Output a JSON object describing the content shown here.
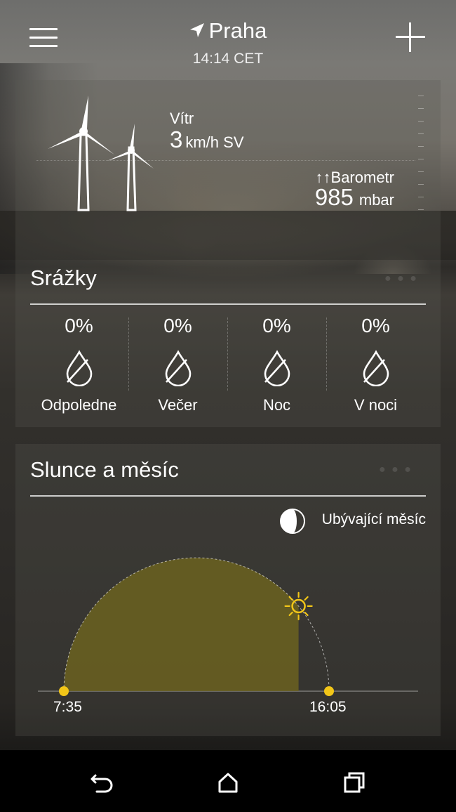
{
  "header": {
    "city": "Praha",
    "time": "14:14 CET",
    "menu_icon": "hamburger-menu-icon",
    "add_icon": "plus-icon",
    "location_icon": "location-arrow-icon"
  },
  "wind": {
    "label": "Vítr",
    "value": "3",
    "unit": "km/h SV",
    "icon": "wind-turbine-icon"
  },
  "barometer": {
    "label": "↑↑Barometr",
    "value": "985",
    "unit": "mbar"
  },
  "precipitation": {
    "title": "Srážky",
    "items": [
      {
        "percent": "0%",
        "label": "Odpoledne"
      },
      {
        "percent": "0%",
        "label": "Večer"
      },
      {
        "percent": "0%",
        "label": "Noc"
      },
      {
        "percent": "0%",
        "label": "V noci"
      }
    ],
    "icon": "raindrop-icon"
  },
  "sun_moon": {
    "title": "Slunce a měsíc",
    "moon_phase": "Ubývající měsíc",
    "sunrise": "7:35",
    "sunset": "16:05",
    "day_progress": 0.78,
    "colors": {
      "fill": "#6b6120",
      "marker": "#f2c618",
      "sun": "#f2c618"
    }
  },
  "navbar": {
    "back_icon": "back-icon",
    "home_icon": "home-icon",
    "recents_icon": "recent-apps-icon"
  }
}
